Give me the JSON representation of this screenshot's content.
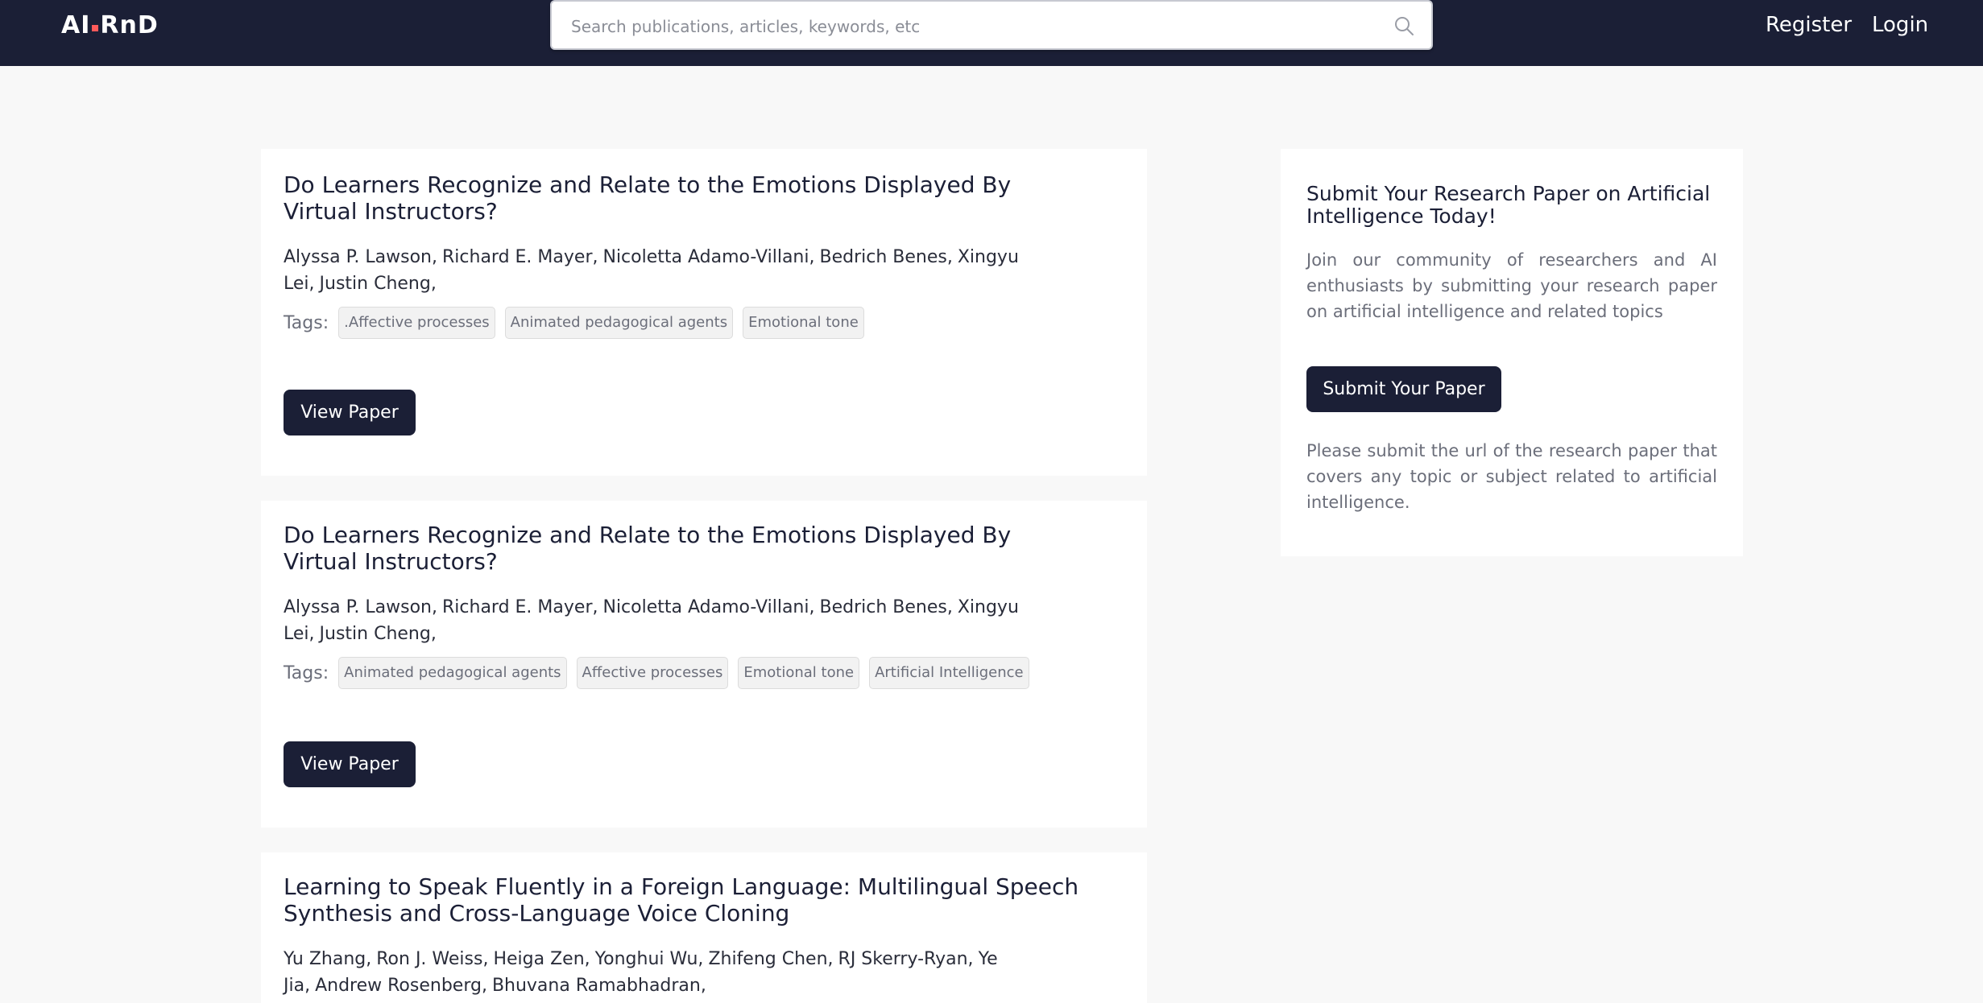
{
  "header": {
    "logo_left": "AI",
    "logo_right": "RnD",
    "search_placeholder": "Search publications, articles, keywords, etc",
    "register_label": "Register",
    "login_label": "Login"
  },
  "papers": [
    {
      "title": "Do Learners Recognize and Relate to the Emotions Displayed By Virtual Instructors?",
      "authors": [
        "Alyssa P. Lawson,",
        "Richard E. Mayer,",
        "Nicoletta Adamo-Villani,",
        "Bedrich Benes,",
        "Xingyu Lei,",
        "Justin Cheng,"
      ],
      "tags_label": "Tags:",
      "tags": [
        ".Affective processes",
        "Animated pedagogical agents",
        "Emotional tone"
      ],
      "button_label": "View Paper"
    },
    {
      "title": "Do Learners Recognize and Relate to the Emotions Displayed By Virtual Instructors?",
      "authors": [
        "Alyssa P. Lawson,",
        "Richard E. Mayer,",
        "Nicoletta Adamo-Villani,",
        "Bedrich Benes,",
        "Xingyu Lei,",
        "Justin Cheng,"
      ],
      "tags_label": "Tags:",
      "tags": [
        "Animated pedagogical agents",
        "Affective processes",
        "Emotional tone",
        "Artificial Intelligence"
      ],
      "button_label": "View Paper"
    },
    {
      "title": "Learning to Speak Fluently in a Foreign Language: Multilingual Speech Synthesis and Cross-Language Voice Cloning",
      "authors": [
        "Yu Zhang,",
        "Ron J. Weiss,",
        "Heiga Zen,",
        "Yonghui Wu,",
        "Zhifeng Chen,",
        "RJ Skerry-Ryan,",
        "Ye Jia,",
        "Andrew Rosenberg,",
        "Bhuvana Ramabhadran,"
      ]
    }
  ],
  "sidebar": {
    "title": "Submit Your Research Paper on Artificial Intelligence Today!",
    "description": "Join our community of researchers and AI enthusiasts by submitting your research paper on artificial intelligence and related topics",
    "submit_label": "Submit Your Paper",
    "note": "Please submit the url of the research paper that covers any topic or subject related to artificial intelligence."
  },
  "colors": {
    "navbar": "#1b1f36",
    "button": "#1b1f36",
    "logo_accent": "#ff5a5a",
    "page_background": "#f8f8f8"
  }
}
